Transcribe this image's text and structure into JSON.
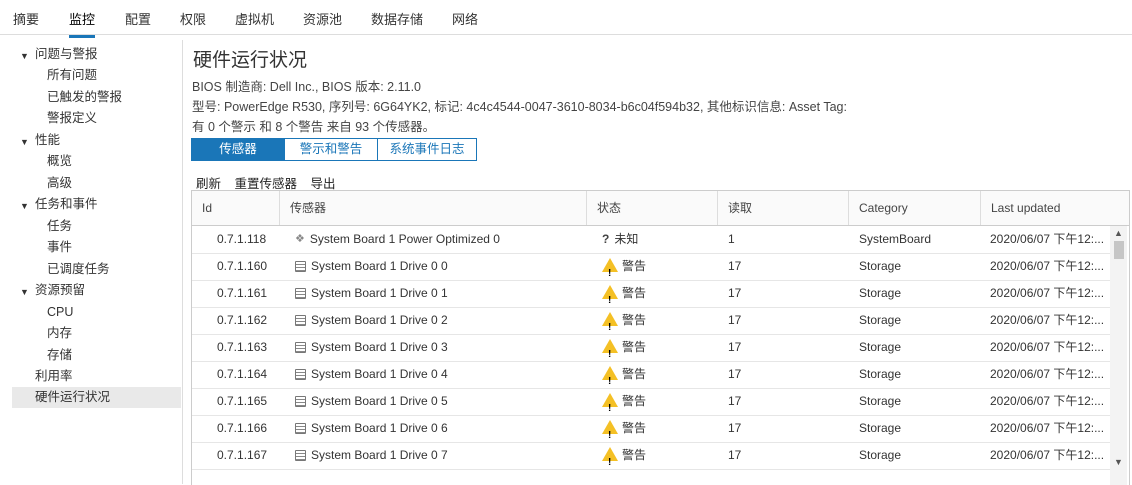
{
  "topnav": {
    "tabs": [
      "摘要",
      "监控",
      "配置",
      "权限",
      "虚拟机",
      "资源池",
      "数据存储",
      "网络"
    ],
    "active_index": 1
  },
  "sidebar": {
    "groups": [
      {
        "label": "问题与警报",
        "items": [
          "所有问题",
          "已触发的警报",
          "警报定义"
        ]
      },
      {
        "label": "性能",
        "items": [
          "概览",
          "高级"
        ]
      },
      {
        "label": "任务和事件",
        "items": [
          "任务",
          "事件",
          "已调度任务"
        ]
      },
      {
        "label": "资源预留",
        "items": [
          "CPU",
          "内存",
          "存储"
        ]
      }
    ],
    "standalone": [
      "利用率",
      "硬件运行状况"
    ],
    "selected": "硬件运行状况"
  },
  "main": {
    "title": "硬件运行状况",
    "bios_line": "BIOS 制造商: Dell Inc., BIOS 版本: 2.11.0",
    "model_line": "型号: PowerEdge R530, 序列号: 6G64YK2, 标记: 4c4c4544-0047-3610-8034-b6c04f594b32, 其他标识信息: Asset Tag:",
    "summary_line": "有 0 个警示 和 8 个警告 来自 93 个传感器。",
    "segments": [
      "传感器",
      "警示和警告",
      "系统事件日志"
    ],
    "active_segment": 0,
    "actions": [
      "刷新",
      "重置传感器",
      "导出"
    ]
  },
  "grid": {
    "columns": [
      "Id",
      "传感器",
      "状态",
      "读取",
      "Category",
      "Last updated"
    ],
    "rows": [
      {
        "id": "0.7.1.118",
        "sensor": "System Board 1 Power Optimized 0",
        "icon": "diamond-icon",
        "status": "未知",
        "status_icon": "question-icon",
        "reading": "1",
        "category": "SystemBoard",
        "updated": "2020/06/07 下午12:..."
      },
      {
        "id": "0.7.1.160",
        "sensor": "System Board 1 Drive 0 0",
        "icon": "drive-icon",
        "status": "警告",
        "status_icon": "warning-icon",
        "reading": "17",
        "category": "Storage",
        "updated": "2020/06/07 下午12:..."
      },
      {
        "id": "0.7.1.161",
        "sensor": "System Board 1 Drive 0 1",
        "icon": "drive-icon",
        "status": "警告",
        "status_icon": "warning-icon",
        "reading": "17",
        "category": "Storage",
        "updated": "2020/06/07 下午12:..."
      },
      {
        "id": "0.7.1.162",
        "sensor": "System Board 1 Drive 0 2",
        "icon": "drive-icon",
        "status": "警告",
        "status_icon": "warning-icon",
        "reading": "17",
        "category": "Storage",
        "updated": "2020/06/07 下午12:..."
      },
      {
        "id": "0.7.1.163",
        "sensor": "System Board 1 Drive 0 3",
        "icon": "drive-icon",
        "status": "警告",
        "status_icon": "warning-icon",
        "reading": "17",
        "category": "Storage",
        "updated": "2020/06/07 下午12:..."
      },
      {
        "id": "0.7.1.164",
        "sensor": "System Board 1 Drive 0 4",
        "icon": "drive-icon",
        "status": "警告",
        "status_icon": "warning-icon",
        "reading": "17",
        "category": "Storage",
        "updated": "2020/06/07 下午12:..."
      },
      {
        "id": "0.7.1.165",
        "sensor": "System Board 1 Drive 0 5",
        "icon": "drive-icon",
        "status": "警告",
        "status_icon": "warning-icon",
        "reading": "17",
        "category": "Storage",
        "updated": "2020/06/07 下午12:..."
      },
      {
        "id": "0.7.1.166",
        "sensor": "System Board 1 Drive 0 6",
        "icon": "drive-icon",
        "status": "警告",
        "status_icon": "warning-icon",
        "reading": "17",
        "category": "Storage",
        "updated": "2020/06/07 下午12:..."
      },
      {
        "id": "0.7.1.167",
        "sensor": "System Board 1 Drive 0 7",
        "icon": "drive-icon",
        "status": "警告",
        "status_icon": "warning-icon",
        "reading": "17",
        "category": "Storage",
        "updated": "2020/06/07 下午12:..."
      }
    ]
  },
  "colors": {
    "accent": "#1a76b8",
    "warning": "#f4c025",
    "selected_bg": "#e9e9e9"
  }
}
